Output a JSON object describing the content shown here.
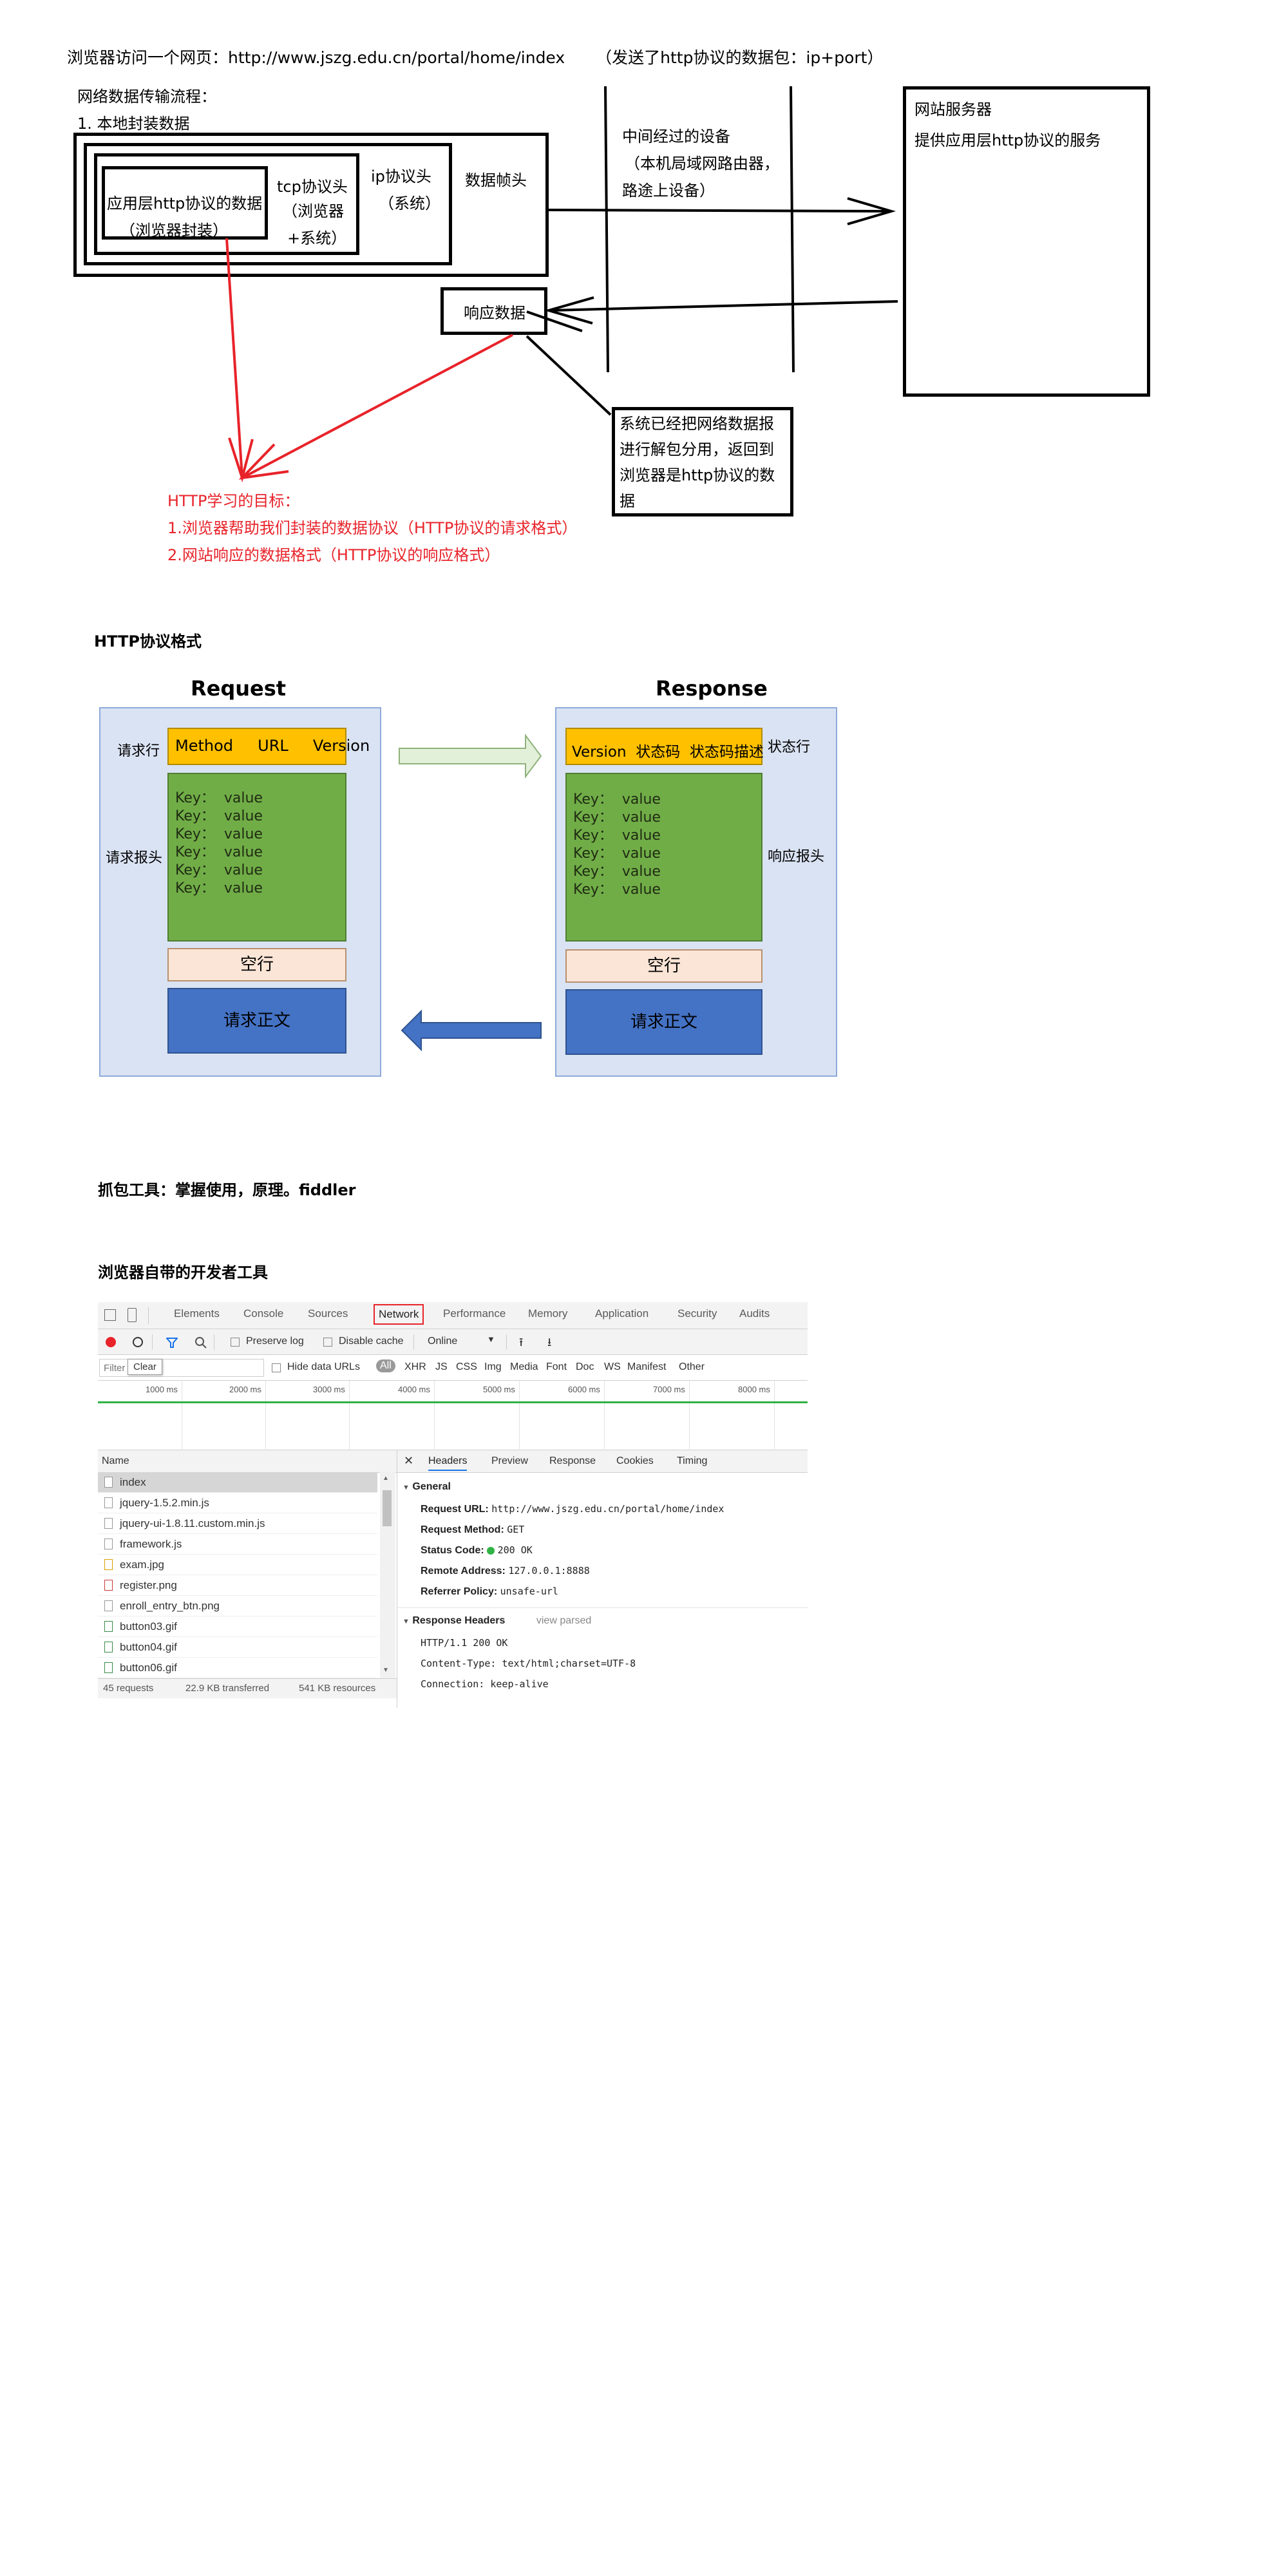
{
  "top_line": {
    "main": "浏览器访问一个网页：http://www.jszg.edu.cn/portal/home/index",
    "note": "（发送了http协议的数据包：ip+port）"
  },
  "flow": {
    "heading": "网络数据传输流程：",
    "step1": "1. 本地封装数据",
    "app_layer_line1": "应用层http协议的数据",
    "app_layer_line2": "（浏览器封装）",
    "tcp_line1": "tcp协议头",
    "tcp_line2": "（浏览器",
    "tcp_line3": "+系统）",
    "ip_line1": "ip协议头",
    "ip_line2": "（系统）",
    "frame": "数据帧头",
    "middle_line1": "中间经过的设备",
    "middle_line2": "（本机局域网路由器，",
    "middle_line3": "路途上设备）",
    "server_line1": "网站服务器",
    "server_line2": "提供应用层http协议的服务",
    "response": "响应数据",
    "system_line1": "系统已经把网络数据报",
    "system_line2": "进行解包分用，返回到",
    "system_line3": "浏览器是http协议的数",
    "system_line4": "据",
    "goal_title": "HTTP学习的目标：",
    "goal1": "1.浏览器帮助我们封装的数据协议（HTTP协议的请求格式）",
    "goal2": "2.网站响应的数据格式（HTTP协议的响应格式）"
  },
  "http_format": {
    "title": "HTTP协议格式",
    "request": {
      "title": "Request",
      "line_label": "请求行",
      "line": "Method     URL     Version",
      "headers_label": "请求报头",
      "headers": [
        "Key：  value",
        "Key：  value",
        "Key：  value",
        "Key：  value",
        "Key：  value",
        "Key：  value"
      ],
      "blank": "空行",
      "body": "请求正文"
    },
    "response": {
      "title": "Response",
      "line_label": "状态行",
      "line": "Version  状态码  状态码描述",
      "headers_label": "响应报头",
      "headers": [
        "Key：  value",
        "Key：  value",
        "Key：  value",
        "Key：  value",
        "Key：  value",
        "Key：  value"
      ],
      "blank": "空行",
      "body": "请求正文"
    },
    "colors": {
      "panel": "#dae3f3",
      "line": "#ffc000",
      "headers": "#70ad47",
      "blank": "#fbe5d6",
      "body": "#4472c4",
      "arrow_right": "#e2f0d9",
      "arrow_left": "#4472c4"
    }
  },
  "capture": {
    "title": "抓包工具：掌握使用，原理。fiddler"
  },
  "devtools_title": "浏览器自带的开发者工具",
  "devtools": {
    "tabs": [
      "Elements",
      "Console",
      "Sources",
      "Network",
      "Performance",
      "Memory",
      "Application",
      "Security",
      "Audits"
    ],
    "active_tab": "Network",
    "toolbar": {
      "preserve_log": "Preserve log",
      "disable_cache": "Disable cache",
      "throttle": "Online"
    },
    "filter": {
      "placeholder": "Filter",
      "tooltip": "Clear",
      "hide_data_urls": "Hide data URLs",
      "types": [
        "All",
        "XHR",
        "JS",
        "CSS",
        "Img",
        "Media",
        "Font",
        "Doc",
        "WS",
        "Manifest",
        "Other"
      ]
    },
    "timeline_ticks": [
      "1000 ms",
      "2000 ms",
      "3000 ms",
      "4000 ms",
      "5000 ms",
      "6000 ms",
      "7000 ms",
      "8000 ms"
    ],
    "list_header": "Name",
    "files": [
      "index",
      "jquery-1.5.2.min.js",
      "jquery-ui-1.8.11.custom.min.js",
      "framework.js",
      "exam.jpg",
      "register.png",
      "enroll_entry_btn.png",
      "button03.gif",
      "button04.gif",
      "button06.gif"
    ],
    "status_bar": [
      "45 requests",
      "22.9 KB transferred",
      "541 KB resources"
    ],
    "detail_tabs": [
      "Headers",
      "Preview",
      "Response",
      "Cookies",
      "Timing"
    ],
    "general": {
      "title": "General",
      "request_url_label": "Request URL:",
      "request_url": "http://www.jszg.edu.cn/portal/home/index",
      "method_label": "Request Method:",
      "method": "GET",
      "status_label": "Status Code:",
      "status": "200 OK",
      "remote_label": "Remote Address:",
      "remote": "127.0.0.1:8888",
      "referrer_label": "Referrer Policy:",
      "referrer": "unsafe-url"
    },
    "response_headers": {
      "title": "Response Headers",
      "view_parsed": "view parsed",
      "lines": [
        "HTTP/1.1 200 OK",
        "Content-Type: text/html;charset=UTF-8",
        "Connection: keep-alive"
      ]
    }
  }
}
